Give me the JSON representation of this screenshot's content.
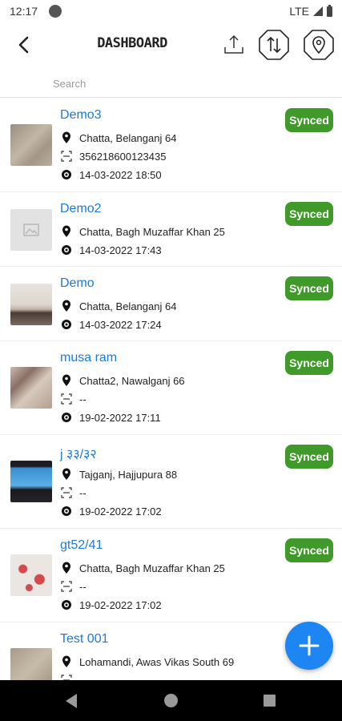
{
  "status_bar": {
    "time": "12:17",
    "network": "LTE"
  },
  "app_bar": {
    "title": "DASHBOARD",
    "icons": [
      "back-arrow-icon",
      "upload-icon",
      "sync-icon",
      "location-pin-icon"
    ]
  },
  "search": {
    "placeholder": "Search",
    "value": ""
  },
  "colors": {
    "accent_blue": "#1e7ad6",
    "synced_green": "#3f9a2a",
    "fab_blue": "#1e86f2"
  },
  "records": [
    {
      "name": "Demo3",
      "location": "Chatta, Belanganj  64",
      "id": "356218600123435",
      "datetime": "14-03-2022 18:50",
      "status": "Synced",
      "thumb": "floor-photo"
    },
    {
      "name": "Demo2",
      "location": "Chatta, Bagh Muzaffar Khan 25",
      "datetime": "14-03-2022 17:43",
      "status": "Synced",
      "thumb": "placeholder-image"
    },
    {
      "name": "Demo",
      "location": "Chatta, Belanganj  64",
      "datetime": "14-03-2022 17:24",
      "status": "Synced",
      "thumb": "person-photo"
    },
    {
      "name": "musa ram",
      "location": "Chatta2, Nawalganj  66",
      "id": "--",
      "datetime": "19-02-2022 17:11",
      "status": "Synced",
      "thumb": "room-photo"
    },
    {
      "name": "j ३३/३२",
      "location": "Tajganj, Hajjupura  88",
      "id": "--",
      "datetime": "19-02-2022 17:02",
      "status": "Synced",
      "thumb": "laptop-photo"
    },
    {
      "name": "gt52/41",
      "location": "Chatta, Bagh Muzaffar Khan 25",
      "id": "--",
      "datetime": "19-02-2022 17:02",
      "status": "Synced",
      "thumb": "fabric-photo"
    },
    {
      "name": "Test 001",
      "location": "Lohamandi, Awas Vikas South  69",
      "thumb": "floor-photo"
    }
  ],
  "fab": {
    "icon": "plus-icon"
  },
  "nav_bar": {
    "icons": [
      "nav-back-icon",
      "nav-home-icon",
      "nav-recents-icon"
    ]
  }
}
